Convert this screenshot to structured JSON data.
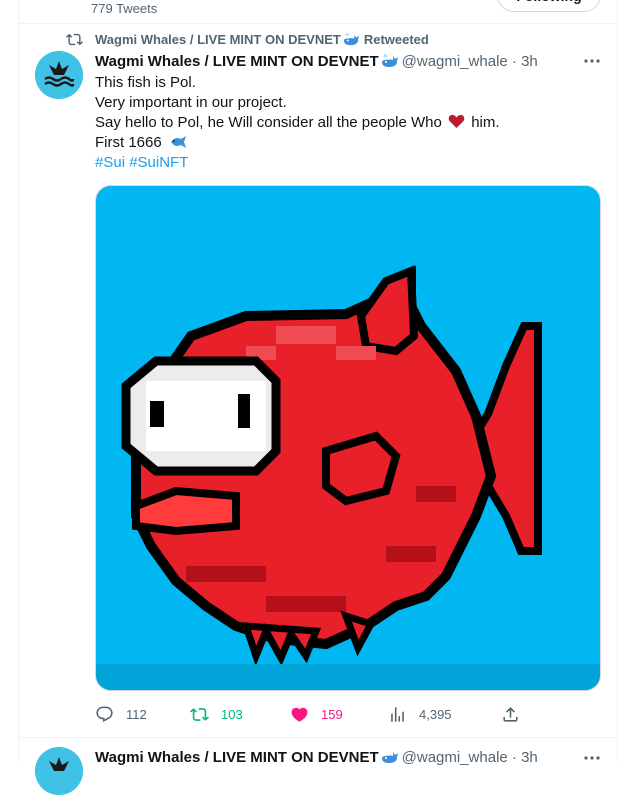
{
  "header": {
    "tweet_count": "779 Tweets",
    "follow_label": "Following"
  },
  "tweet": {
    "retweet_label": "Wagmi Whales / LIVE MINT ON DEVNET",
    "retweet_suffix": "Retweeted",
    "display_name": "Wagmi Whales / LIVE MINT ON DEVNET",
    "handle_time": "@wagmi_whale · 3h",
    "text_lines": {
      "line1": "This fish is Pol.",
      "line2": "Very important in our project.",
      "line3_before": "Say hello to Pol, he Will consider all  the people Who",
      "line3_after": "him.",
      "line4": "First 1666",
      "hashtag1": "#Sui",
      "hashtag2": "#SuiNFT"
    },
    "media_alt": "pixel art red fish",
    "actions": {
      "replies": "112",
      "retweets": "103",
      "likes": "159",
      "views": "4,395"
    }
  },
  "next_tweet": {
    "display_name": "Wagmi Whales / LIVE MINT ON DEVNET",
    "handle_time": "@wagmi_whale · 3h"
  },
  "colors": {
    "accent": "#1d9bf0",
    "retweet_green": "#00ba7c",
    "like_pink": "#f91880",
    "secondary_text": "#536471",
    "media_bg": "#00b7f1",
    "fish_red": "#e8202a"
  },
  "icons": {
    "retweet": "retweet-icon",
    "reply": "reply-icon",
    "like": "heart-icon",
    "views": "views-icon",
    "share": "share-icon",
    "more": "more-icon",
    "whale_emoji": "whale-emoji-icon",
    "fish_emoji": "fish-emoji-icon"
  }
}
